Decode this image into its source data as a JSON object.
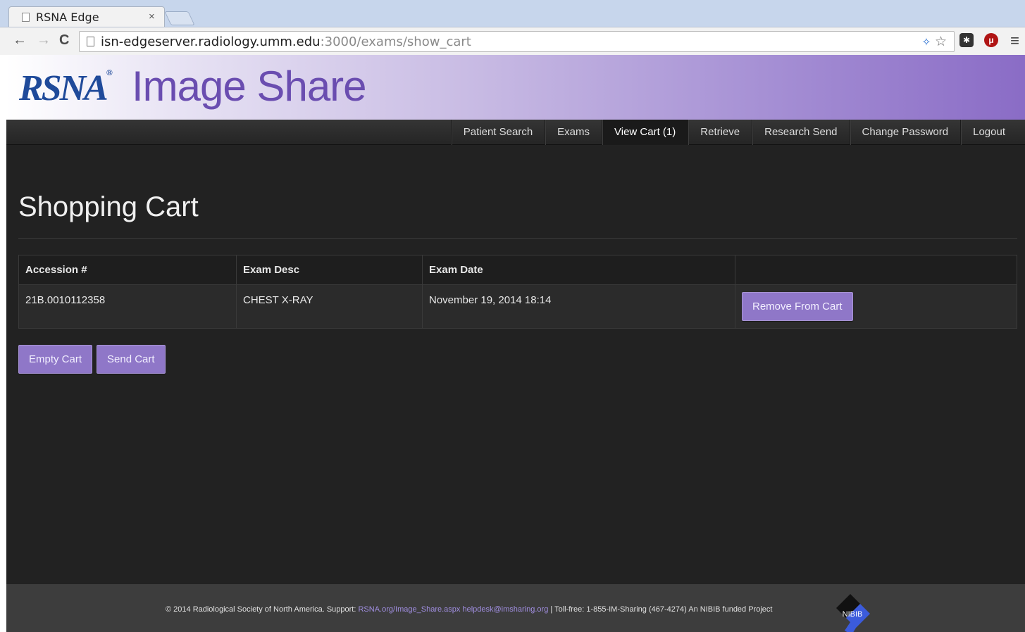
{
  "browser": {
    "tab_title": "RSNA Edge",
    "tab_close": "×",
    "url_host": "isn-edgeserver.radiology.umm.edu",
    "url_path": ":3000/exams/show_cart",
    "back": "←",
    "forward": "→",
    "reload": "C",
    "star": "☆",
    "menu": "≡"
  },
  "header": {
    "logo_rsna": "RSNA",
    "logo_reg": "®",
    "logo_product": "Image Share"
  },
  "nav": {
    "items": [
      {
        "label": "Patient Search"
      },
      {
        "label": "Exams"
      },
      {
        "label": "View Cart (1)"
      },
      {
        "label": "Retrieve"
      },
      {
        "label": "Research Send"
      },
      {
        "label": "Change Password"
      },
      {
        "label": "Logout"
      }
    ],
    "active_index": 2
  },
  "main": {
    "title": "Shopping Cart",
    "table": {
      "headers": [
        "Accession #",
        "Exam Desc",
        "Exam Date",
        ""
      ],
      "rows": [
        {
          "accession": "21B.0010112358",
          "desc": "CHEST X-RAY",
          "date": "November 19, 2014 18:14",
          "action": "Remove From Cart"
        }
      ]
    },
    "empty_cart": "Empty Cart",
    "send_cart": "Send Cart"
  },
  "footer": {
    "copyright": "© 2014 Radiological Society of North America. Support: ",
    "support_link": "RSNA.org/Image_Share.aspx",
    "email_link": "helpdesk@imsharing.org",
    "tollfree": " | Toll-free: 1-855-IM-Sharing (467-4274)    An NIBIB funded Project",
    "nibib_logo": "NIBIB"
  },
  "colors": {
    "accent": "#8f77c8",
    "page_bg": "#222222",
    "brand_blue": "#1f4a9a",
    "brand_purple": "#6a4db0"
  }
}
